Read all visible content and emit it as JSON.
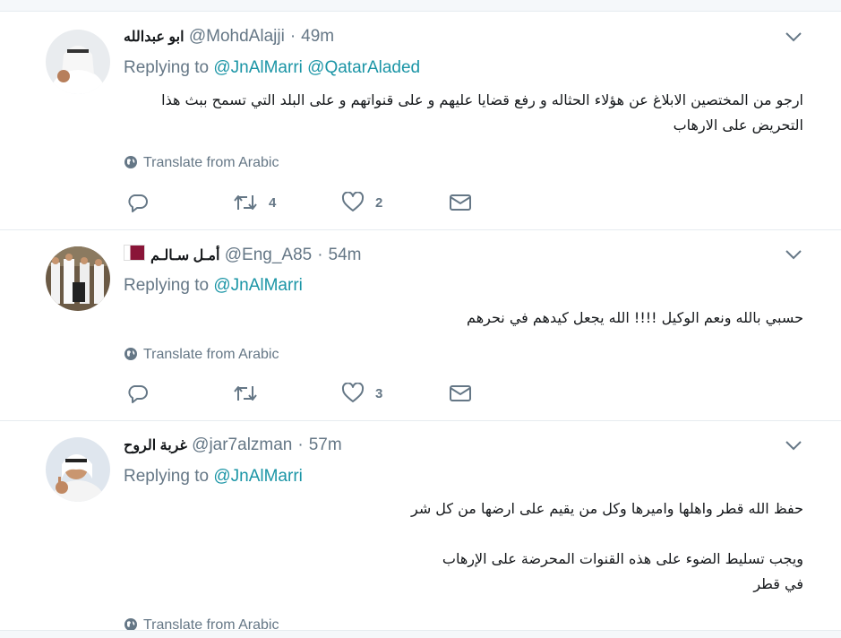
{
  "tweets": [
    {
      "name": "ابو عبدالله",
      "handle": "@MohdAlajji",
      "time": "49m",
      "replying_label": "Replying to",
      "replying_to": [
        "@JnAlMarri",
        "@QatarAladed"
      ],
      "text_lines": [
        "ارجو من المختصين الابلاغ عن هؤلاء الحثاله و رفع قضايا عليهم و على قنواتهم و على البلد التي تسمح ببث هذا",
        "التحريض على الارهاب"
      ],
      "translate_label": "Translate from Arabic",
      "retweets": "4",
      "likes": "2"
    },
    {
      "name": "أمـل سـالـم",
      "has_flag": true,
      "handle": "@Eng_A85",
      "time": "54m",
      "replying_label": "Replying to",
      "replying_to": [
        "@JnAlMarri"
      ],
      "text_lines": [
        "حسبي بالله ونعم الوكيل !!!! الله يجعل كيدهم في نحرهم"
      ],
      "translate_label": "Translate from Arabic",
      "retweets": "",
      "likes": "3"
    },
    {
      "name": "غربة الروح",
      "handle": "@jar7alzman",
      "time": "57m",
      "replying_label": "Replying to",
      "replying_to": [
        "@JnAlMarri"
      ],
      "text_lines": [
        "حفظ الله قطر واهلها واميرها وكل من يقيم على ارضها من كل شر",
        "",
        "ويجب تسليط الضوء على هذه القنوات المحرضة على الإرهاب",
        "في قطر"
      ],
      "translate_label": "Translate from Arabic"
    }
  ],
  "colors": {
    "link": "#1b95a6",
    "secondary": "#657786",
    "divider": "#e6ecf0"
  }
}
